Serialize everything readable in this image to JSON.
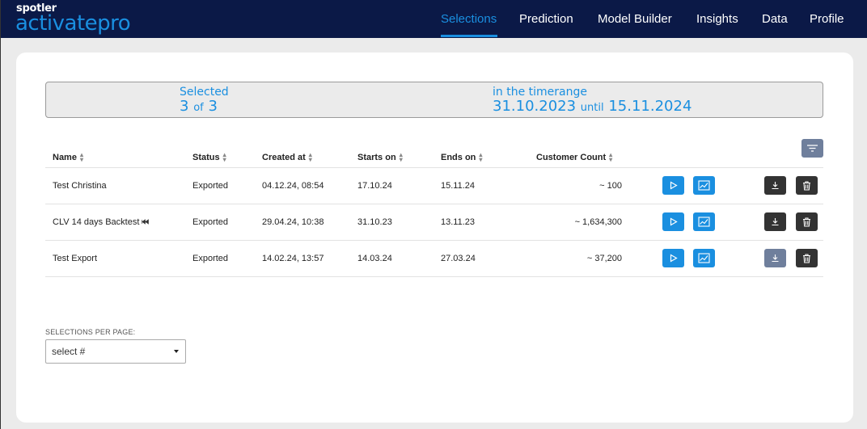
{
  "brand": {
    "top": "spotler",
    "main": "activatepro"
  },
  "nav": {
    "items": [
      {
        "label": "Selections",
        "active": true
      },
      {
        "label": "Prediction",
        "active": false
      },
      {
        "label": "Model Builder",
        "active": false
      },
      {
        "label": "Insights",
        "active": false
      },
      {
        "label": "Data",
        "active": false
      },
      {
        "label": "Profile",
        "active": false
      }
    ]
  },
  "summary": {
    "selected_label": "Selected",
    "selected_count": "3",
    "of_label": "of",
    "total_count": "3",
    "timerange_label": "in the timerange",
    "start_date": "31.10.2023",
    "until_label": "until",
    "end_date": "15.11.2024"
  },
  "table": {
    "headers": [
      "Name",
      "Status",
      "Created at",
      "Starts on",
      "Ends on",
      "Customer Count"
    ],
    "rows": [
      {
        "name": "Test Christina",
        "status": "Exported",
        "created": "04.12.24, 08:54",
        "starts": "17.10.24",
        "ends": "15.11.24",
        "count": "~ 100",
        "download_enabled": true
      },
      {
        "name": "CLV 14 days Backtest",
        "status": "Exported",
        "created": "29.04.24, 10:38",
        "starts": "31.10.23",
        "ends": "13.11.23",
        "count": "~ 1,634,300",
        "download_enabled": true
      },
      {
        "name": "Test Export",
        "status": "Exported",
        "created": "14.02.24, 13:57",
        "starts": "14.03.24",
        "ends": "27.03.24",
        "count": "~ 37,200",
        "download_enabled": false
      }
    ]
  },
  "per_page": {
    "label": "SELECTIONS PER PAGE:",
    "value": "select #"
  },
  "colors": {
    "navy": "#0b1947",
    "accent": "#1a8fe0",
    "dark_button": "#333333",
    "disabled_button": "#6f7f9c"
  }
}
